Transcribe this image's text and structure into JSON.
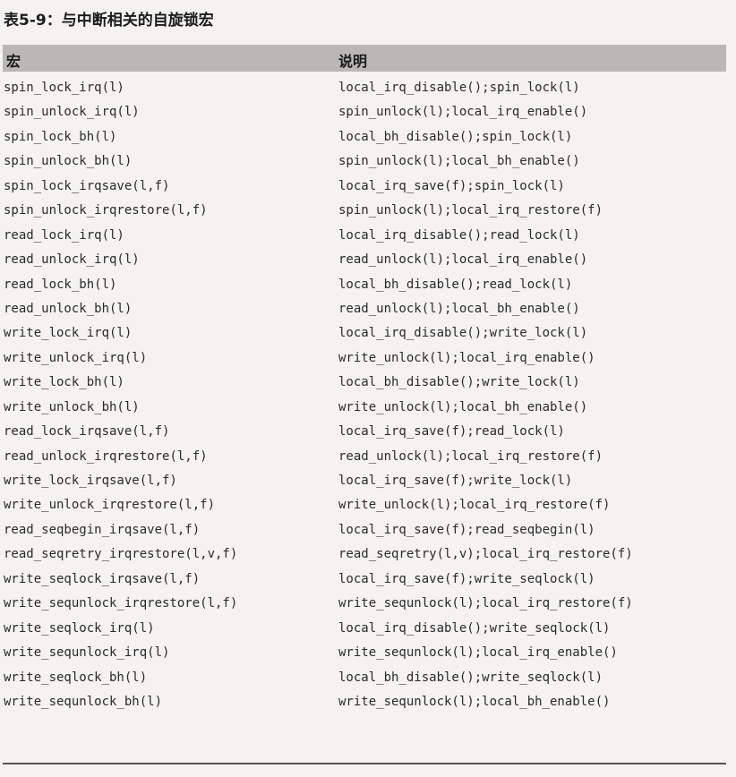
{
  "title": "表5-9：与中断相关的自旋锁宏",
  "table": {
    "headers": [
      "宏",
      "说明"
    ],
    "rows": [
      [
        "spin_lock_irq(l)",
        "local_irq_disable();spin_lock(l)"
      ],
      [
        "spin_unlock_irq(l)",
        "spin_unlock(l);local_irq_enable()"
      ],
      [
        "spin_lock_bh(l)",
        "local_bh_disable();spin_lock(l)"
      ],
      [
        "spin_unlock_bh(l)",
        "spin_unlock(l);local_bh_enable()"
      ],
      [
        "spin_lock_irqsave(l,f)",
        "local_irq_save(f);spin_lock(l)"
      ],
      [
        "spin_unlock_irqrestore(l,f)",
        "spin_unlock(l);local_irq_restore(f)"
      ],
      [
        "read_lock_irq(l)",
        "local_irq_disable();read_lock(l)"
      ],
      [
        "read_unlock_irq(l)",
        "read_unlock(l);local_irq_enable()"
      ],
      [
        "read_lock_bh(l)",
        "local_bh_disable();read_lock(l)"
      ],
      [
        "read_unlock_bh(l)",
        "read_unlock(l);local_bh_enable()"
      ],
      [
        "write_lock_irq(l)",
        "local_irq_disable();write_lock(l)"
      ],
      [
        "write_unlock_irq(l)",
        "write_unlock(l);local_irq_enable()"
      ],
      [
        "write_lock_bh(l)",
        "local_bh_disable();write_lock(l)"
      ],
      [
        "write_unlock_bh(l)",
        "write_unlock(l);local_bh_enable()"
      ],
      [
        "read_lock_irqsave(l,f)",
        "local_irq_save(f);read_lock(l)"
      ],
      [
        "read_unlock_irqrestore(l,f)",
        "read_unlock(l);local_irq_restore(f)"
      ],
      [
        "write_lock_irqsave(l,f)",
        "local_irq_save(f);write_lock(l)"
      ],
      [
        "write_unlock_irqrestore(l,f)",
        "write_unlock(l);local_irq_restore(f)"
      ],
      [
        "read_seqbegin_irqsave(l,f)",
        "local_irq_save(f);read_seqbegin(l)"
      ],
      [
        "read_seqretry_irqrestore(l,v,f)",
        "read_seqretry(l,v);local_irq_restore(f)"
      ],
      [
        "write_seqlock_irqsave(l,f)",
        "local_irq_save(f);write_seqlock(l)"
      ],
      [
        "write_sequnlock_irqrestore(l,f)",
        "write_sequnlock(l);local_irq_restore(f)"
      ],
      [
        "write_seqlock_irq(l)",
        "local_irq_disable();write_seqlock(l)"
      ],
      [
        "write_sequnlock_irq(l)",
        "write_sequnlock(l);local_irq_enable()"
      ],
      [
        "write_seqlock_bh(l)",
        "local_bh_disable();write_seqlock(l)"
      ],
      [
        "write_sequnlock_bh(l)",
        "write_sequnlock(l);local_bh_enable()"
      ]
    ]
  }
}
